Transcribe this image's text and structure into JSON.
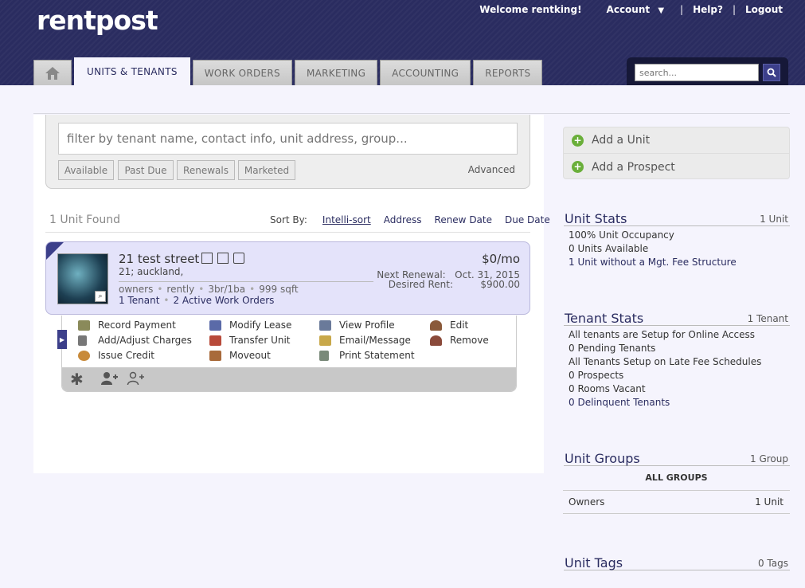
{
  "logo": "rentpost",
  "topnav": {
    "welcome": "Welcome rentking!",
    "account": "Account",
    "caret": "▼",
    "help": "Help?",
    "logout": "Logout",
    "sep": "|"
  },
  "tabs": [
    {
      "label": "UNITS & TENANTS"
    },
    {
      "label": "WORK ORDERS"
    },
    {
      "label": "MARKETING"
    },
    {
      "label": "ACCOUNTING"
    },
    {
      "label": "REPORTS"
    }
  ],
  "search": {
    "placeholder": "search..."
  },
  "filter": {
    "placeholder": "filter by tenant name, contact info, unit address, group...",
    "buttons": [
      "Available",
      "Past Due",
      "Renewals",
      "Marketed"
    ],
    "advanced": "Advanced"
  },
  "results": {
    "found": "1 Unit Found",
    "sort_by": "Sort By:",
    "sort_options": [
      "Intelli-sort",
      "Address",
      "Renew Date",
      "Due Date"
    ]
  },
  "unit": {
    "title": "21 test street",
    "subtitle": "21; auckland,",
    "meta": [
      "owners",
      "rently",
      "3br/1ba",
      "999 sqft"
    ],
    "links": [
      "1 Tenant",
      "2 Active Work Orders"
    ],
    "price": "$0/mo",
    "renewal_label": "Next Renewal:",
    "renewal_value": "Oct. 31, 2015",
    "rent_label": "Desired Rent:",
    "rent_value": "$900.00"
  },
  "actions": [
    {
      "label": "Record Payment",
      "icon": "payment-icon",
      "color": "#8a8a5a"
    },
    {
      "label": "Add/Adjust Charges",
      "icon": "calculator-icon",
      "color": "#777777"
    },
    {
      "label": "Issue Credit",
      "icon": "cookie-icon",
      "color": "#c88a3a"
    },
    {
      "label": "Modify Lease",
      "icon": "lease-icon",
      "color": "#5a6aa8"
    },
    {
      "label": "Transfer Unit",
      "icon": "house-transfer-icon",
      "color": "#b84a3a"
    },
    {
      "label": "Moveout",
      "icon": "house-moveout-icon",
      "color": "#a86a3a"
    },
    {
      "label": "View Profile",
      "icon": "profile-card-icon",
      "color": "#6a7a9a"
    },
    {
      "label": "Email/Message",
      "icon": "email-icon",
      "color": "#c8a84a"
    },
    {
      "label": "Print Statement",
      "icon": "statement-icon",
      "color": "#7a8a7a"
    },
    {
      "label": "Edit",
      "icon": "user-edit-icon",
      "color": "#8a5a3a"
    },
    {
      "label": "Remove",
      "icon": "user-remove-icon",
      "color": "#8a4a3a"
    }
  ],
  "sidebar": {
    "add_unit": "Add a Unit",
    "add_prospect": "Add a Prospect",
    "unit_stats": {
      "title": "Unit Stats",
      "count": "1 Unit",
      "items": [
        "100% Unit Occupancy",
        "0 Units Available",
        "1 Unit without a Mgt. Fee Structure"
      ]
    },
    "tenant_stats": {
      "title": "Tenant Stats",
      "count": "1 Tenant",
      "items": [
        "All tenants are Setup for Online Access",
        "0 Pending Tenants",
        "All Tenants Setup on Late Fee Schedules",
        "0 Prospects",
        "0 Rooms Vacant",
        "0 Delinquent Tenants"
      ]
    },
    "unit_groups": {
      "title": "Unit Groups",
      "count": "1 Group",
      "all": "ALL GROUPS",
      "group_name": "Owners",
      "group_count": "1 Unit"
    },
    "unit_tags": {
      "title": "Unit Tags",
      "count": "0 Tags"
    }
  }
}
